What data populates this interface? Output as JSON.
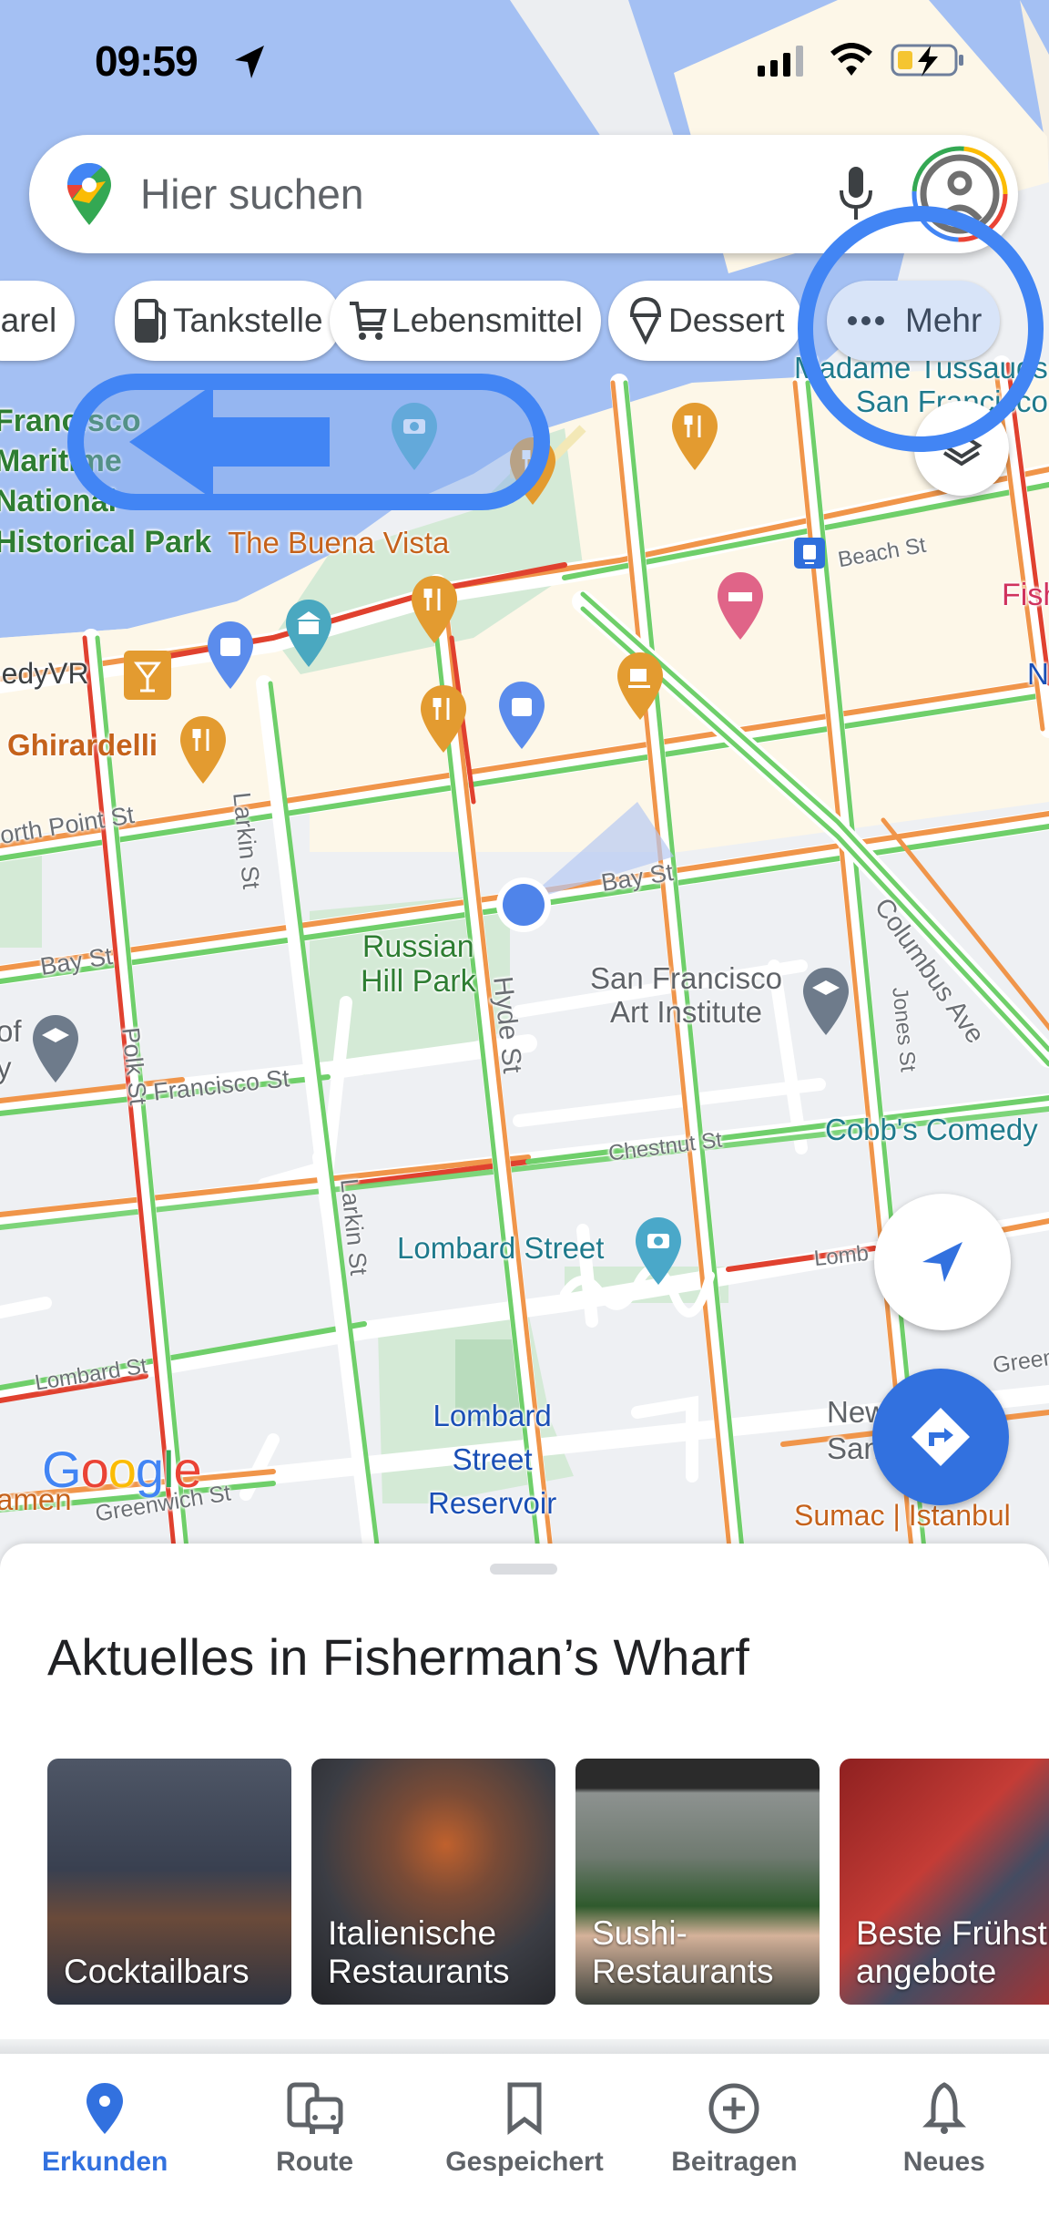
{
  "status_bar": {
    "time": "09:59",
    "battery_state": "charging-low"
  },
  "search": {
    "placeholder": "Hier suchen"
  },
  "chips": [
    {
      "label": "parel",
      "icon": "clothing-icon"
    },
    {
      "label": "Tankstelle",
      "icon": "gas-station-icon"
    },
    {
      "label": "Lebensmittel",
      "icon": "cart-icon"
    },
    {
      "label": "Dessert",
      "icon": "ice-cream-icon"
    },
    {
      "label": "Mehr",
      "icon": "more-dots-icon"
    }
  ],
  "map": {
    "labels": {
      "maritime": "Francisco\nMaritime\nNational\nHistorical Park",
      "buena_vista": "The Buena Vista",
      "comedyvr": "ComedyVR",
      "ghirardelli": "Ghirardelli",
      "north_point": "North Point St",
      "larkin_1": "Larkin St",
      "larkin_2": "Larkin St",
      "bay_st_1": "Bay St",
      "bay_st_2": "Bay St",
      "beach_st": "Beach St",
      "russian_hill": "Russian\nHill Park",
      "hyde_st": "Hyde St",
      "sf_art": "San Francisco\nArt Institute",
      "columbus": "Columbus Ave",
      "jones": "Jones St",
      "francisco_st": "Francisco St",
      "polk_st": "Polk St",
      "chestnut": "Chestnut St",
      "cobbs": "Cobb's Comedy",
      "lombard_street": "Lombard Street",
      "lombard_st": "Lombard St",
      "lombard_right": "Lomb",
      "reservoir": "Lombard\nStreet\nReservoir",
      "greenwich": "Greenwich St",
      "green": "Green",
      "new_sf": "New ... of\nSan ...co",
      "sumac": "Sumac | Istanbul",
      "madame": "Madame Tussauds\nSan Francisco",
      "fish": "Fish",
      "n_label": "N",
      "amen": "amen",
      "of_y": "of\ny",
      "google": "Google"
    }
  },
  "sheet": {
    "title": "Aktuelles in Fisherman’s Wharf",
    "cards": [
      {
        "title": "Cocktailbars"
      },
      {
        "title": "Italienische Restaurants"
      },
      {
        "title": "Sushi-\nRestaurants"
      },
      {
        "title": "Beste Frühstücks-\nangebote"
      }
    ]
  },
  "nav": [
    {
      "label": "Erkunden",
      "icon": "explore-pin-icon",
      "active": true
    },
    {
      "label": "Route",
      "icon": "commute-icon",
      "active": false
    },
    {
      "label": "Gespeichert",
      "icon": "bookmark-icon",
      "active": false
    },
    {
      "label": "Beitragen",
      "icon": "add-circle-icon",
      "active": false
    },
    {
      "label": "Neues",
      "icon": "bell-icon",
      "active": false
    }
  ],
  "colors": {
    "accent": "#3271df",
    "annotation": "#4285f4",
    "traffic_green": "#6fcf6a",
    "traffic_orange": "#f0954a",
    "traffic_red": "#e0412f"
  }
}
